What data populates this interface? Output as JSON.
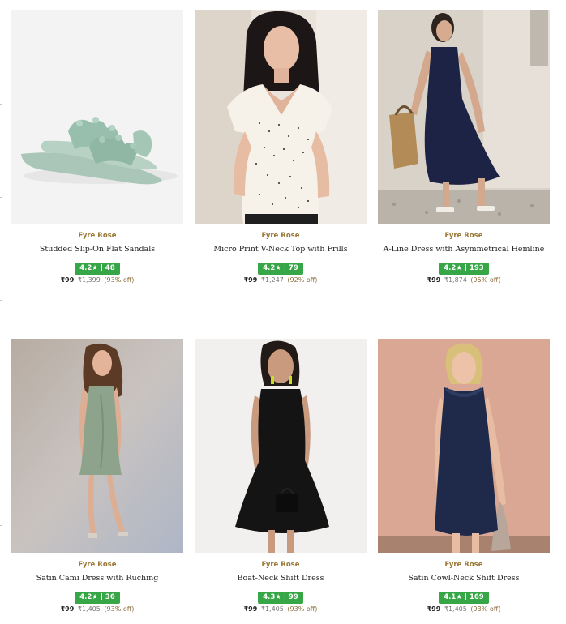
{
  "products": [
    {
      "brand": "Fyre Rose",
      "title": "Studded Slip-On Flat Sandals",
      "rating": "4.2★ | 48",
      "price": "₹99",
      "mrp": "₹1,399",
      "discount": "(93% off)",
      "image": "sandals-image"
    },
    {
      "brand": "Fyre Rose",
      "title": "Micro Print V-Neck Top with Frills",
      "rating": "4.2★ | 79",
      "price": "₹99",
      "mrp": "₹1,247",
      "discount": "(92% off)",
      "image": "polka-top-image"
    },
    {
      "brand": "Fyre Rose",
      "title": "A-Line Dress with Asymmetrical Hemline",
      "rating": "4.2★ | 193",
      "price": "₹99",
      "mrp": "₹1,874",
      "discount": "(95% off)",
      "image": "navy-dress-image"
    },
    {
      "brand": "Fyre Rose",
      "title": "Satin Cami Dress with Ruching",
      "rating": "4.2★ | 36",
      "price": "₹99",
      "mrp": "₹1,405",
      "discount": "(93% off)",
      "image": "green-satin-dress-image"
    },
    {
      "brand": "Fyre Rose",
      "title": "Boat-Neck Shift Dress",
      "rating": "4.3★ | 99",
      "price": "₹99",
      "mrp": "₹1,405",
      "discount": "(93% off)",
      "image": "black-dress-image"
    },
    {
      "brand": "Fyre Rose",
      "title": "Satin Cowl-Neck Shift Dress",
      "rating": "4.1★ | 169",
      "price": "₹99",
      "mrp": "₹1,405",
      "discount": "(93% off)",
      "image": "navy-satin-dress-image"
    }
  ],
  "colors": {
    "brand": "#9a7736",
    "rating_badge": "#36a646",
    "text": "#222222"
  }
}
